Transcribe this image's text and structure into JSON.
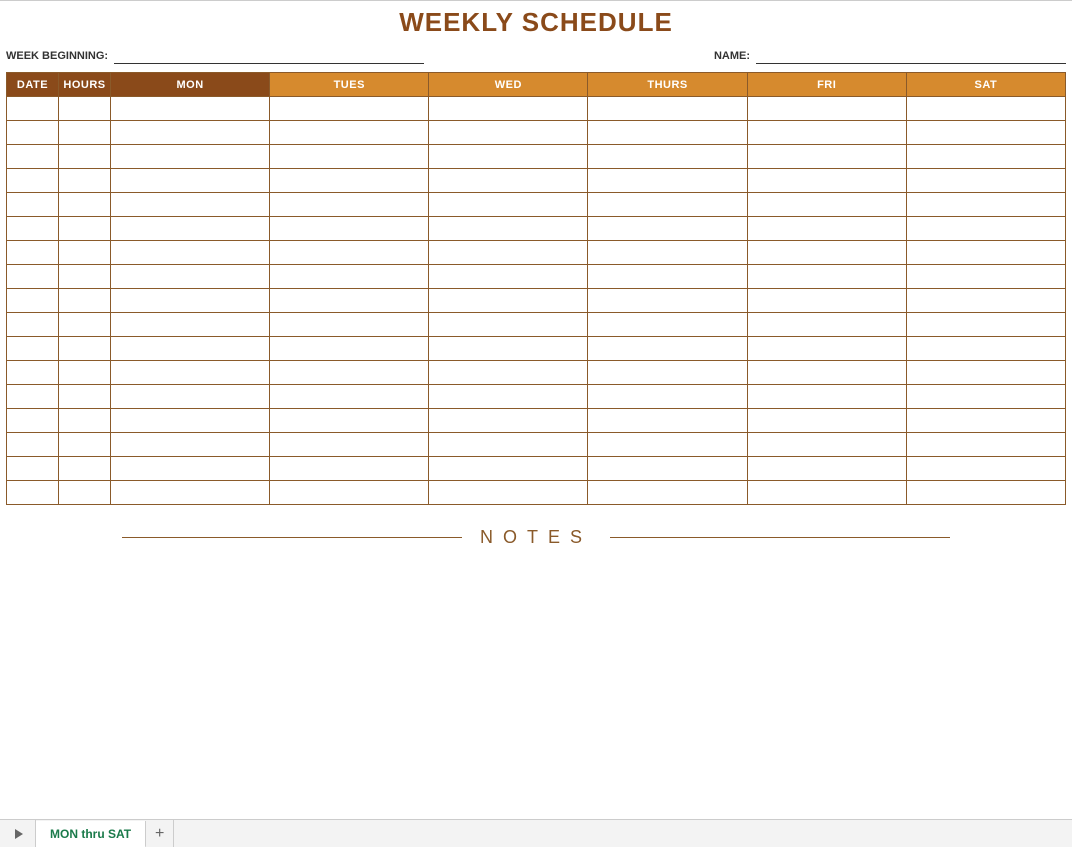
{
  "title": "WEEKLY SCHEDULE",
  "meta": {
    "week_beginning_label": "WEEK BEGINNING:",
    "week_beginning_value": "",
    "name_label": "NAME:",
    "name_value": ""
  },
  "columns": {
    "date": "DATE",
    "hours": "HOURS",
    "mon": "MON",
    "tues": "TUES",
    "wed": "WED",
    "thurs": "THURS",
    "fri": "FRI",
    "sat": "SAT"
  },
  "row_count": 17,
  "notes_label": "NOTES",
  "tabs": {
    "active": "MON thru SAT"
  }
}
